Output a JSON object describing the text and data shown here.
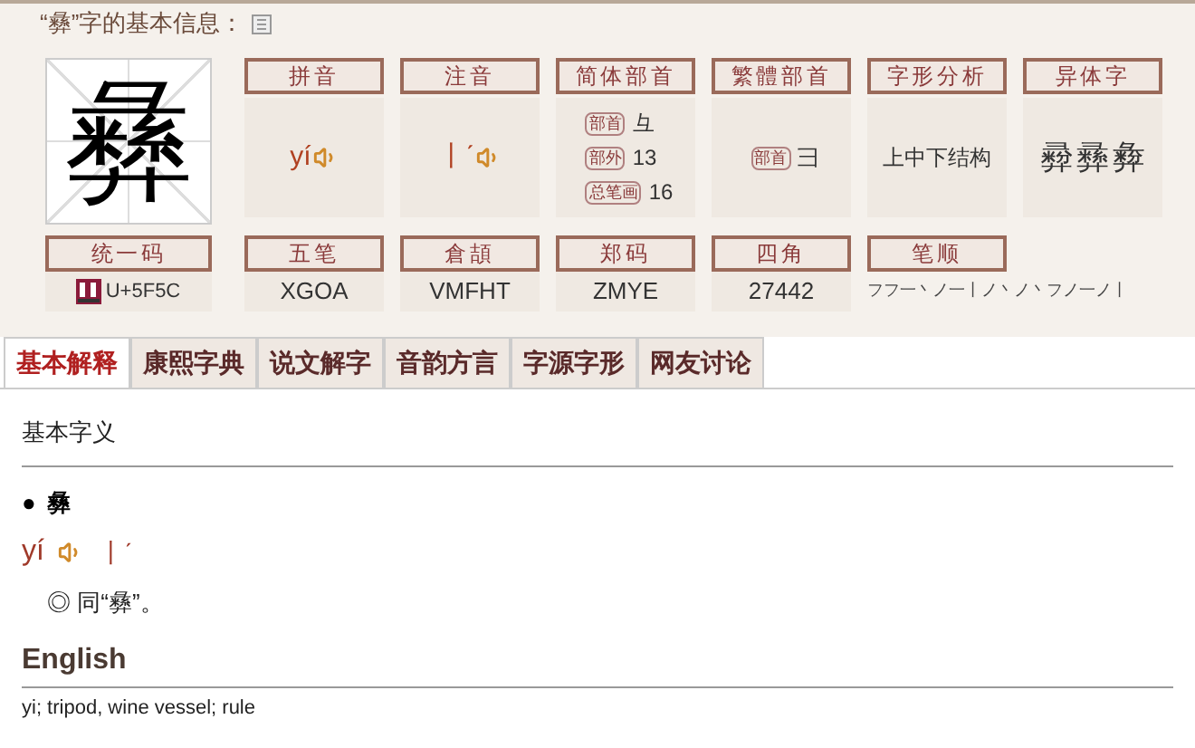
{
  "header": {
    "title": "“彝”字的基本信息："
  },
  "character": "彝",
  "row1": [
    {
      "label": "拼音",
      "kind": "sound",
      "value": "yí"
    },
    {
      "label": "注音",
      "kind": "sound",
      "value": "丨ˊ"
    },
    {
      "label": "简体部首",
      "kind": "radical",
      "lines": [
        {
          "tag": "部首",
          "value": "彑"
        },
        {
          "tag": "部外",
          "value": "13"
        },
        {
          "tag": "总笔画",
          "value": "16"
        }
      ]
    },
    {
      "label": "繁體部首",
      "kind": "radical",
      "lines": [
        {
          "tag": "部首",
          "value": "彐"
        }
      ]
    },
    {
      "label": "字形分析",
      "kind": "text",
      "value": "上中下结构"
    },
    {
      "label": "异体字",
      "kind": "variants",
      "values": [
        "彛",
        "彞",
        "彜"
      ]
    }
  ],
  "row2": [
    {
      "label": "统一码",
      "kind": "unicode",
      "value": "U+5F5C"
    },
    {
      "label": "五笔",
      "kind": "text",
      "value": "XGOA"
    },
    {
      "label": "倉頡",
      "kind": "text",
      "value": "VMFHT"
    },
    {
      "label": "郑码",
      "kind": "text",
      "value": "ZMYE"
    },
    {
      "label": "四角",
      "kind": "text",
      "value": "27442"
    },
    {
      "label": "笔顺",
      "kind": "strokes",
      "value": "フフ一丶ノ一丨ノ丶ノ丶フノ一ノ丨"
    }
  ],
  "tabs": [
    {
      "label": "基本解释",
      "selected": true
    },
    {
      "label": "康熙字典",
      "selected": false
    },
    {
      "label": "说文解字",
      "selected": false
    },
    {
      "label": "音韵方言",
      "selected": false
    },
    {
      "label": "字源字形",
      "selected": false
    },
    {
      "label": "网友讨论",
      "selected": false
    }
  ],
  "basic": {
    "title": "基本字义",
    "entry": "彝",
    "bullet": "●",
    "pinyin": "yí",
    "zhuyin": "丨ˊ",
    "definition": "◎ 同“彝”。"
  },
  "english": {
    "title": "English",
    "text": "yi; tripod, wine vessel; rule"
  }
}
